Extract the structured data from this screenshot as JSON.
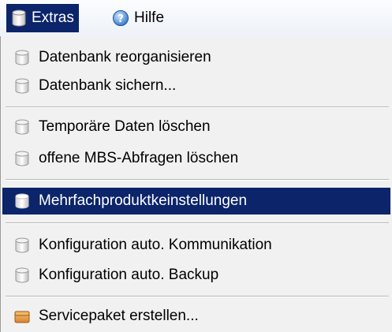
{
  "menubar": {
    "extras": {
      "label": "Extras",
      "icon": "database-icon"
    },
    "help": {
      "label": "Hilfe",
      "icon": "help-icon"
    }
  },
  "menu": {
    "items": [
      {
        "label": "Datenbank reorganisieren",
        "icon": "database-icon",
        "enabled": false
      },
      {
        "label": "Datenbank sichern...",
        "icon": "database-icon",
        "enabled": false
      },
      {
        "label": "Temporäre Daten löschen",
        "icon": "database-icon",
        "enabled": false
      },
      {
        "label": "offene MBS-Abfragen löschen",
        "icon": "database-icon",
        "enabled": false
      },
      {
        "label": "Mehrfachproduktkeinstellungen",
        "icon": "database-icon",
        "enabled": true,
        "highlighted": true
      },
      {
        "label": "Konfiguration auto. Kommunikation",
        "icon": "database-icon",
        "enabled": false
      },
      {
        "label": "Konfiguration auto. Backup",
        "icon": "database-icon",
        "enabled": false
      },
      {
        "label": "Servicepaket erstellen...",
        "icon": "package-icon",
        "enabled": true
      }
    ]
  },
  "colors": {
    "highlight": "#0b246a",
    "menu_bg": "#f1f1f1"
  }
}
